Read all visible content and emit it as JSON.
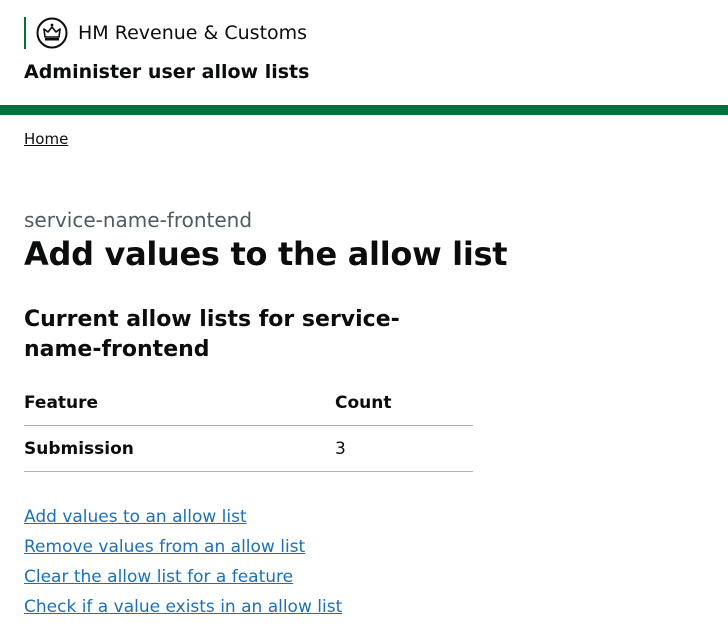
{
  "header": {
    "crest_icon": "royal-crest-icon",
    "organisation": "HM Revenue & Customs",
    "service_name": "Administer user allow lists",
    "accent_color": "#00703c"
  },
  "breadcrumb": {
    "home": "Home"
  },
  "main": {
    "caption": "service-name-frontend",
    "title": "Add values to the allow list",
    "section_title": "Current allow lists for service-name-frontend",
    "table": {
      "headers": [
        "Feature",
        "Count"
      ],
      "rows": [
        {
          "feature": "Submission",
          "count": "3"
        }
      ]
    },
    "links": [
      "Add values to an allow list",
      "Remove values from an allow list",
      "Clear the allow list for a feature",
      "Check if a value exists in an allow list"
    ],
    "link_color": "#1d70b8"
  }
}
